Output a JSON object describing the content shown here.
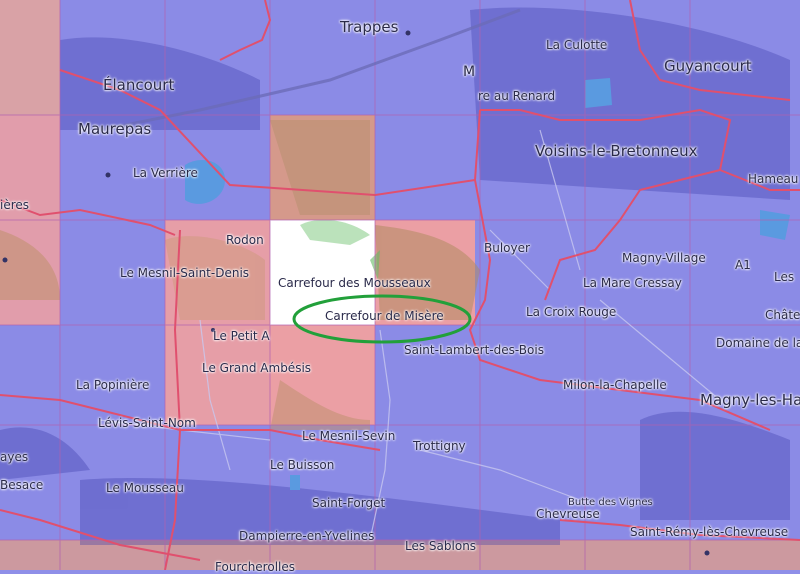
{
  "map": {
    "grid": {
      "cols": 8,
      "rows": 6
    },
    "colors": {
      "blue_cell": "#8b8be6",
      "red_cell": "#f0a0a0",
      "white_cell": "#ffffff",
      "road": "#e0506e",
      "highlight_ellipse": "#22a03a"
    },
    "highlight": {
      "place": "Carrefour de Misère",
      "shape": "ellipse",
      "color": "#22a03a"
    },
    "labels": [
      {
        "id": "trappes",
        "text": "Trappes"
      },
      {
        "id": "la-culotte",
        "text": "La Culotte"
      },
      {
        "id": "guyancourt",
        "text": "Guyancourt"
      },
      {
        "id": "elancourt",
        "text": "Élancourt"
      },
      {
        "id": "m",
        "text": "M"
      },
      {
        "id": "re-au-renard",
        "text": "re au Renard"
      },
      {
        "id": "maurepas",
        "text": "Maurepas"
      },
      {
        "id": "voisins",
        "text": "Voisins-le-Bretonneux"
      },
      {
        "id": "la-verriere",
        "text": "La Verrière"
      },
      {
        "id": "hameau",
        "text": "Hameau"
      },
      {
        "id": "ieres",
        "text": "ières"
      },
      {
        "id": "rodon",
        "text": "Rodon"
      },
      {
        "id": "buloyer",
        "text": "Buloyer"
      },
      {
        "id": "le-mesnil-saint-denis",
        "text": "Le Mesnil-Saint-Denis"
      },
      {
        "id": "magny-village",
        "text": "Magny-Village"
      },
      {
        "id": "a1",
        "text": "A1"
      },
      {
        "id": "les",
        "text": "Les"
      },
      {
        "id": "carrefour-mousseaux",
        "text": "Carrefour des Mousseaux"
      },
      {
        "id": "la-mare-cressay",
        "text": "La Mare Cressay"
      },
      {
        "id": "carrefour-misere",
        "text": "Carrefour de Misère"
      },
      {
        "id": "la-croix-rouge",
        "text": "La Croix Rouge"
      },
      {
        "id": "chate",
        "text": "Châte"
      },
      {
        "id": "le-petit-a",
        "text": "Le Petit A"
      },
      {
        "id": "domaine-de-la",
        "text": "Domaine de la"
      },
      {
        "id": "saint-lambert",
        "text": "Saint-Lambert-des-Bois"
      },
      {
        "id": "le-grand-ambesis",
        "text": "Le Grand Ambésis"
      },
      {
        "id": "milon",
        "text": "Milon-la-Chapelle"
      },
      {
        "id": "la-popiniere",
        "text": "La Popinière"
      },
      {
        "id": "magny-les-ham",
        "text": "Magny-les-Ham"
      },
      {
        "id": "levis",
        "text": "Lévis-Saint-Nom"
      },
      {
        "id": "le-mesnil-sevin",
        "text": "Le Mesnil-Sevin"
      },
      {
        "id": "trottigny",
        "text": "Trottigny"
      },
      {
        "id": "ayes",
        "text": "ayes"
      },
      {
        "id": "le-buisson",
        "text": "Le Buisson"
      },
      {
        "id": "besace",
        "text": "Besace"
      },
      {
        "id": "le-mousseau",
        "text": "Le Mousseau"
      },
      {
        "id": "butte-des-vignes",
        "text": "Butte des Vignes"
      },
      {
        "id": "saint-forget",
        "text": "Saint-Forget"
      },
      {
        "id": "chevreuse",
        "text": "Chevreuse"
      },
      {
        "id": "saint-remy",
        "text": "Saint-Rémy-lès-Chevreuse"
      },
      {
        "id": "dampierre",
        "text": "Dampierre-en-Yvelines"
      },
      {
        "id": "les-sablons",
        "text": "Les Sablons"
      },
      {
        "id": "fourcherolles",
        "text": "Fourcherolles"
      }
    ]
  }
}
